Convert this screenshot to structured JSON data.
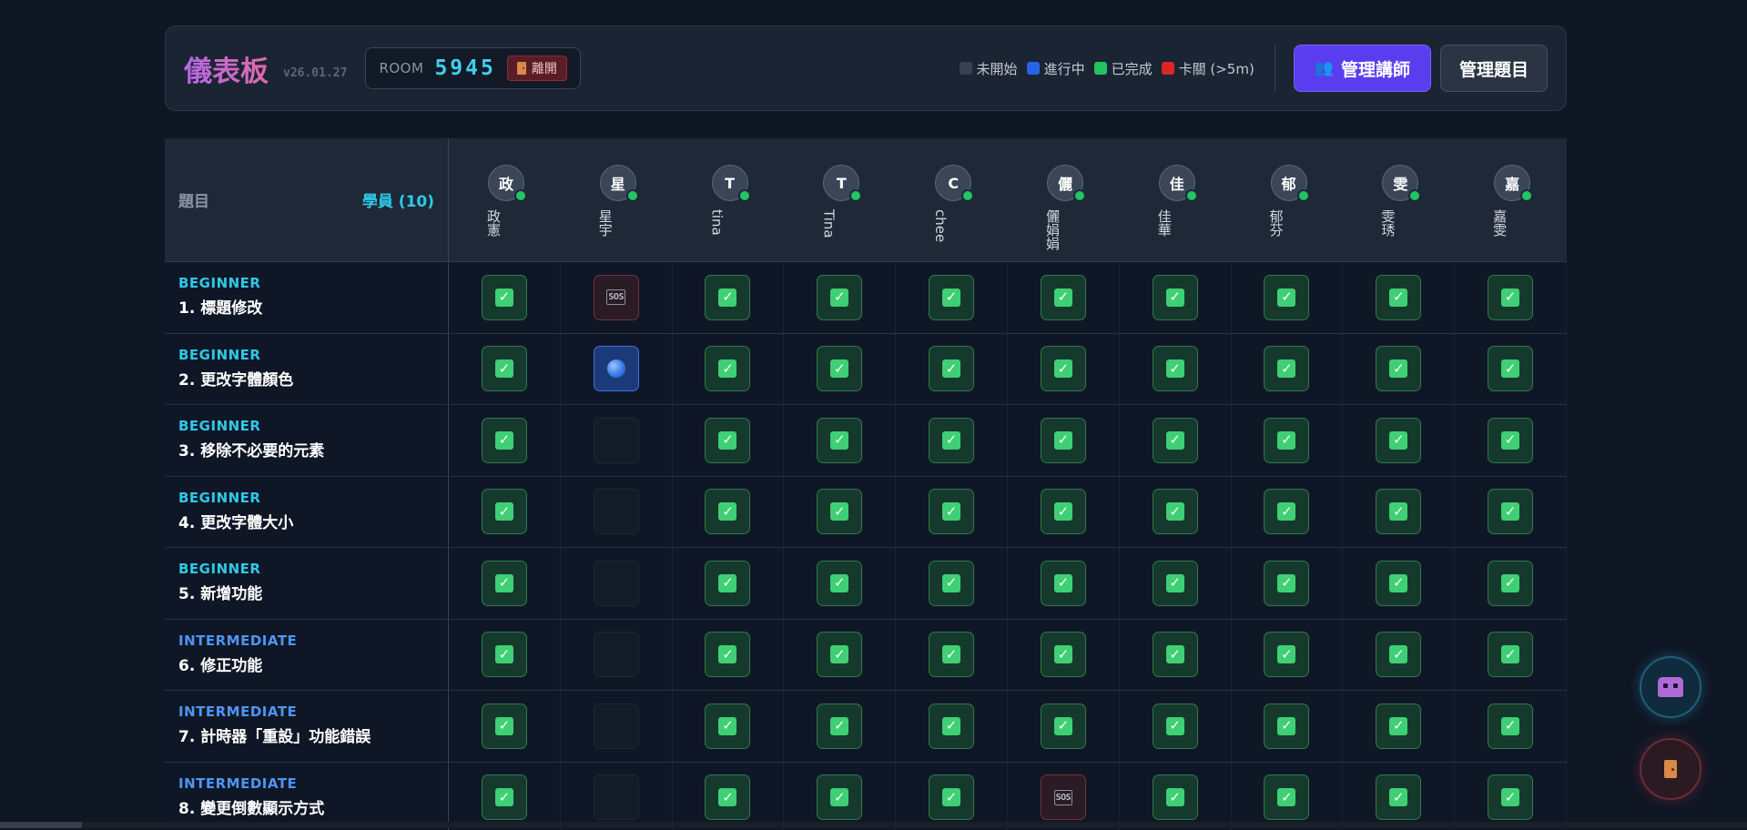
{
  "header": {
    "title": "儀表板",
    "version": "v26.01.27",
    "room_label": "ROOM",
    "room_code": "5945",
    "leave_label": "離開",
    "legend": [
      {
        "label": "未開始",
        "color": "#374151"
      },
      {
        "label": "進行中",
        "color": "#2563eb"
      },
      {
        "label": "已完成",
        "color": "#22c55e"
      },
      {
        "label": "卡關 (>5m)",
        "color": "#dc2626"
      }
    ],
    "manage_tutor_label": "管理講師",
    "manage_problems_label": "管理題目"
  },
  "table": {
    "problem_header": "題目",
    "students_header": "學員 (10)",
    "students": [
      {
        "initial": "政",
        "name": "政憲"
      },
      {
        "initial": "星",
        "name": "星宇"
      },
      {
        "initial": "T",
        "name": "tina"
      },
      {
        "initial": "T",
        "name": "Tina"
      },
      {
        "initial": "C",
        "name": "chee"
      },
      {
        "initial": "儷",
        "name": "儷娟娟"
      },
      {
        "initial": "佳",
        "name": "佳華"
      },
      {
        "initial": "郁",
        "name": "郁芬"
      },
      {
        "initial": "雯",
        "name": "雯琇"
      },
      {
        "initial": "嘉",
        "name": "嘉雯"
      }
    ],
    "problems": [
      {
        "level": "BEGINNER",
        "title": "1. 標題修改",
        "status": [
          "done",
          "stuck",
          "done",
          "done",
          "done",
          "done",
          "done",
          "done",
          "done",
          "done"
        ]
      },
      {
        "level": "BEGINNER",
        "title": "2. 更改字體顏色",
        "status": [
          "done",
          "progress",
          "done",
          "done",
          "done",
          "done",
          "done",
          "done",
          "done",
          "done"
        ]
      },
      {
        "level": "BEGINNER",
        "title": "3. 移除不必要的元素",
        "status": [
          "done",
          "none",
          "done",
          "done",
          "done",
          "done",
          "done",
          "done",
          "done",
          "done"
        ]
      },
      {
        "level": "BEGINNER",
        "title": "4. 更改字體大小",
        "status": [
          "done",
          "none",
          "done",
          "done",
          "done",
          "done",
          "done",
          "done",
          "done",
          "done"
        ]
      },
      {
        "level": "BEGINNER",
        "title": "5. 新增功能",
        "status": [
          "done",
          "none",
          "done",
          "done",
          "done",
          "done",
          "done",
          "done",
          "done",
          "done"
        ]
      },
      {
        "level": "INTERMEDIATE",
        "title": "6. 修正功能",
        "status": [
          "done",
          "none",
          "done",
          "done",
          "done",
          "done",
          "done",
          "done",
          "done",
          "done"
        ]
      },
      {
        "level": "INTERMEDIATE",
        "title": "7. 計時器「重設」功能錯誤",
        "status": [
          "done",
          "none",
          "done",
          "done",
          "done",
          "done",
          "done",
          "done",
          "done",
          "done"
        ]
      },
      {
        "level": "INTERMEDIATE",
        "title": "8. 變更倒數顯示方式",
        "status": [
          "done",
          "none",
          "done",
          "done",
          "done",
          "stuck",
          "done",
          "done",
          "done",
          "done"
        ]
      }
    ]
  },
  "icons": {
    "checkmark": "check-icon",
    "sos": "SOS",
    "in_progress": "globe-icon",
    "ai_assistant": "alien-icon",
    "exit": "door-icon"
  }
}
